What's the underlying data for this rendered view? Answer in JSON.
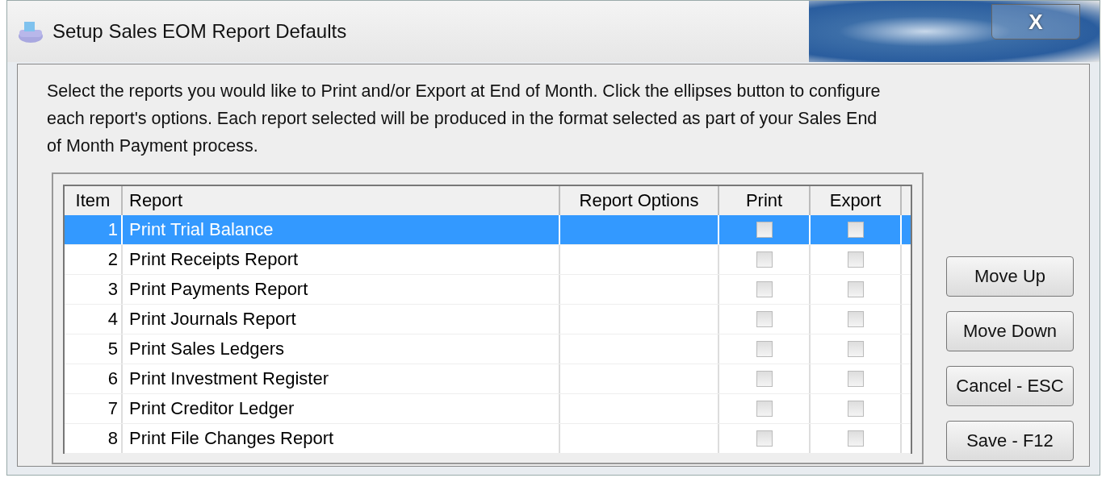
{
  "window": {
    "title": "Setup Sales EOM Report Defaults",
    "close": "X"
  },
  "instructions": "Select the reports you would like to Print and/or Export at End of Month. Click the ellipses button to configure each report's options. Each report selected will be produced in the format selected as part of your Sales End of Month Payment process.",
  "table": {
    "columns": [
      "Item",
      "Report",
      "Report Options",
      "Print",
      "Export"
    ],
    "rows": [
      {
        "item": "1",
        "report": "Print Trial Balance",
        "selected": true,
        "print": false,
        "export": false
      },
      {
        "item": "2",
        "report": "Print Receipts Report",
        "selected": false,
        "print": false,
        "export": false
      },
      {
        "item": "3",
        "report": "Print Payments Report",
        "selected": false,
        "print": false,
        "export": false
      },
      {
        "item": "4",
        "report": "Print Journals Report",
        "selected": false,
        "print": false,
        "export": false
      },
      {
        "item": "5",
        "report": "Print Sales Ledgers",
        "selected": false,
        "print": false,
        "export": false
      },
      {
        "item": "6",
        "report": "Print Investment Register",
        "selected": false,
        "print": false,
        "export": false
      },
      {
        "item": "7",
        "report": "Print Creditor Ledger",
        "selected": false,
        "print": false,
        "export": false
      },
      {
        "item": "8",
        "report": "Print File Changes Report",
        "selected": false,
        "print": false,
        "export": false
      }
    ]
  },
  "buttons": [
    "Move Up",
    "Move Down",
    "Cancel - ESC",
    "Save - F12"
  ]
}
